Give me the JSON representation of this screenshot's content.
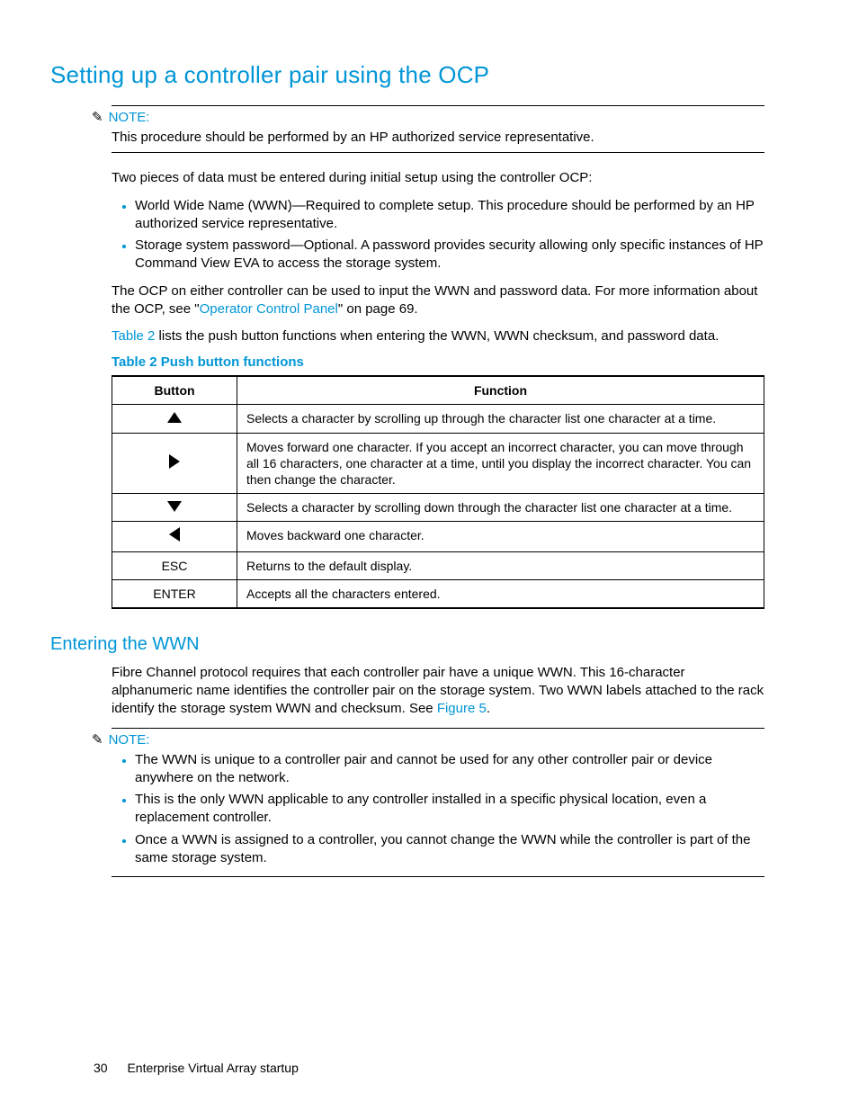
{
  "heading": "Setting up a controller pair using the OCP",
  "note1": {
    "label": "NOTE:",
    "text": "This procedure should be performed by an HP authorized service representative."
  },
  "intro": "Two pieces of data must be entered during initial setup using the controller OCP:",
  "intro_list": [
    "World Wide Name (WWN)—Required to complete setup. This procedure should be performed by an HP authorized service representative.",
    "Storage system password—Optional. A password provides security allowing only specific instances of HP Command View EVA to access the storage system."
  ],
  "ocp_para_pre": "The OCP on either controller can be used to input the WWN and password data. For more information about the OCP, see \"",
  "ocp_link": "Operator Control Panel",
  "ocp_para_post": "\" on page 69.",
  "table_ref_pre": "",
  "table_ref_link": "Table 2",
  "table_ref_post": " lists the push button functions when entering the WWN, WWN checksum, and password data.",
  "table_caption_num": "Table 2",
  "table_caption_title": " Push button functions",
  "table_headers": {
    "button": "Button",
    "function": "Function"
  },
  "table_rows": [
    {
      "btn": "up",
      "fn": "Selects a character by scrolling up through the character list one character at a time."
    },
    {
      "btn": "right",
      "fn": "Moves forward one character. If you accept an incorrect character, you can move through all 16 characters, one character at a time, until you display the incorrect character. You can then change the character."
    },
    {
      "btn": "down",
      "fn": "Selects a character by scrolling down through the character list one character at a time."
    },
    {
      "btn": "left",
      "fn": "Moves backward one character."
    },
    {
      "btn": "ESC",
      "fn": "Returns to the default display."
    },
    {
      "btn": "ENTER",
      "fn": "Accepts all the characters entered."
    }
  ],
  "subheading": "Entering the WWN",
  "wwn_para_pre": "Fibre Channel protocol requires that each controller pair have a unique WWN. This 16-character alphanumeric name identifies the controller pair on the storage system. Two WWN labels attached to the rack identify the storage system WWN and checksum. See ",
  "wwn_link": "Figure 5",
  "wwn_para_post": ".",
  "note2": {
    "label": "NOTE:",
    "items": [
      "The WWN is unique to a controller pair and cannot be used for any other controller pair or device anywhere on the network.",
      "This is the only WWN applicable to any controller installed in a specific physical location, even a replacement controller.",
      "Once a WWN is assigned to a controller, you cannot change the WWN while the controller is part of the same storage system."
    ]
  },
  "footer": {
    "page": "30",
    "title": "Enterprise Virtual Array startup"
  }
}
